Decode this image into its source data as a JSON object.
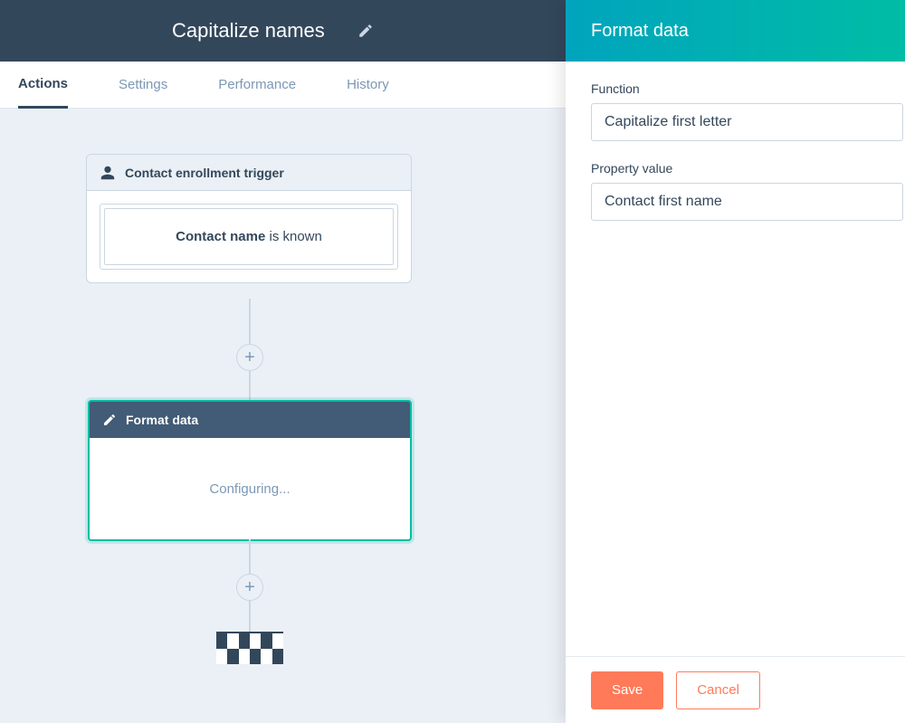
{
  "header": {
    "title": "Capitalize names"
  },
  "tabs": [
    {
      "label": "Actions",
      "active": true
    },
    {
      "label": "Settings",
      "active": false
    },
    {
      "label": "Performance",
      "active": false
    },
    {
      "label": "History",
      "active": false
    }
  ],
  "trigger_card": {
    "title": "Contact enrollment trigger",
    "property_name": "Contact name",
    "condition_text": " is known"
  },
  "action_card": {
    "title": "Format data",
    "status": "Configuring..."
  },
  "panel": {
    "title": "Format data",
    "function_label": "Function",
    "function_value": "Capitalize first letter",
    "property_label": "Property value",
    "property_value": "Contact first name",
    "save_label": "Save",
    "cancel_label": "Cancel"
  }
}
